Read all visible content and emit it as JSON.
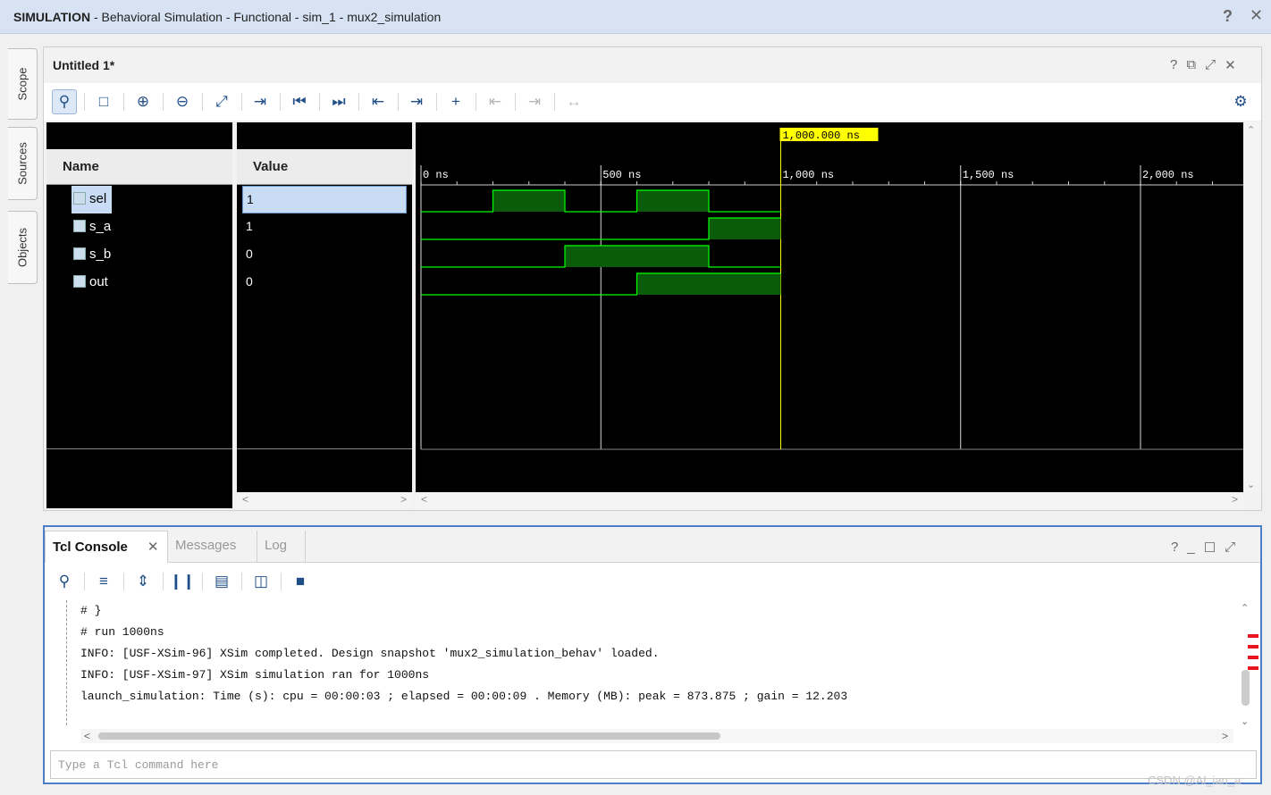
{
  "window": {
    "title_bold": "SIMULATION",
    "title_rest": " - Behavioral Simulation - Functional - sim_1 - mux2_simulation",
    "help": "?",
    "close": "✕"
  },
  "side_tabs": [
    "Scope",
    "Sources",
    "Objects"
  ],
  "wave_panel": {
    "title": "Untitled 1*",
    "controls": [
      "?",
      "⧉",
      "⤢",
      "✕"
    ],
    "toolbar_icons": [
      "search-icon",
      "save-icon",
      "zoom-in-icon",
      "zoom-out-icon",
      "zoom-fit-icon",
      "goto-cursor-icon",
      "goto-start-icon",
      "goto-end-icon",
      "previous-transition-icon",
      "next-transition-icon",
      "add-marker-icon",
      "previous-marker-icon",
      "next-marker-icon",
      "swap-cursors-icon",
      "settings-icon"
    ],
    "name_header": "Name",
    "value_header": "Value",
    "signals": [
      {
        "name": "sel",
        "value": "1"
      },
      {
        "name": "s_a",
        "value": "1"
      },
      {
        "name": "s_b",
        "value": "0"
      },
      {
        "name": "out",
        "value": "0"
      }
    ],
    "cursor_label": "1,000.000 ns",
    "time_ticks": [
      "0 ns",
      "500 ns",
      "1,000 ns",
      "1,500 ns",
      "2,000 ns"
    ],
    "waveforms": {
      "unit": "ns",
      "sel": [
        [
          0,
          0
        ],
        [
          200,
          1
        ],
        [
          400,
          0
        ],
        [
          600,
          1
        ],
        [
          800,
          0
        ],
        [
          1000,
          0
        ]
      ],
      "s_a": [
        [
          0,
          0
        ],
        [
          800,
          1
        ],
        [
          1000,
          1
        ]
      ],
      "s_b": [
        [
          0,
          0
        ],
        [
          400,
          1
        ],
        [
          800,
          0
        ],
        [
          1000,
          0
        ]
      ],
      "out": [
        [
          0,
          0
        ],
        [
          600,
          1
        ],
        [
          1000,
          1
        ]
      ]
    }
  },
  "tcl_panel": {
    "tabs": [
      {
        "label": "Tcl Console",
        "close": "✕"
      },
      {
        "label": "Messages"
      },
      {
        "label": "Log"
      }
    ],
    "controls": [
      "?",
      "_",
      "☐",
      "⤢"
    ],
    "toolbar_icons": [
      "search-icon",
      "collapse-all-icon",
      "expand-all-icon",
      "pause-icon",
      "copy-icon",
      "columns-icon",
      "clear-icon"
    ],
    "lines": [
      "# }",
      "# run 1000ns",
      "INFO: [USF-XSim-96] XSim completed. Design snapshot 'mux2_simulation_behav' loaded.",
      "INFO: [USF-XSim-97] XSim simulation ran for 1000ns",
      "launch_simulation: Time (s): cpu = 00:00:03 ; elapsed = 00:00:09 . Memory (MB): peak = 873.875 ; gain = 12.203"
    ],
    "input_placeholder": "Type a Tcl command here"
  },
  "watermark": "CSDN @Al_ian_a",
  "colors": {
    "wave_fill": "#0a5c0a",
    "wave_line": "#00ff00",
    "cursor": "#ffff00",
    "grid": "#ffffff",
    "accent": "#4e7ec8"
  }
}
